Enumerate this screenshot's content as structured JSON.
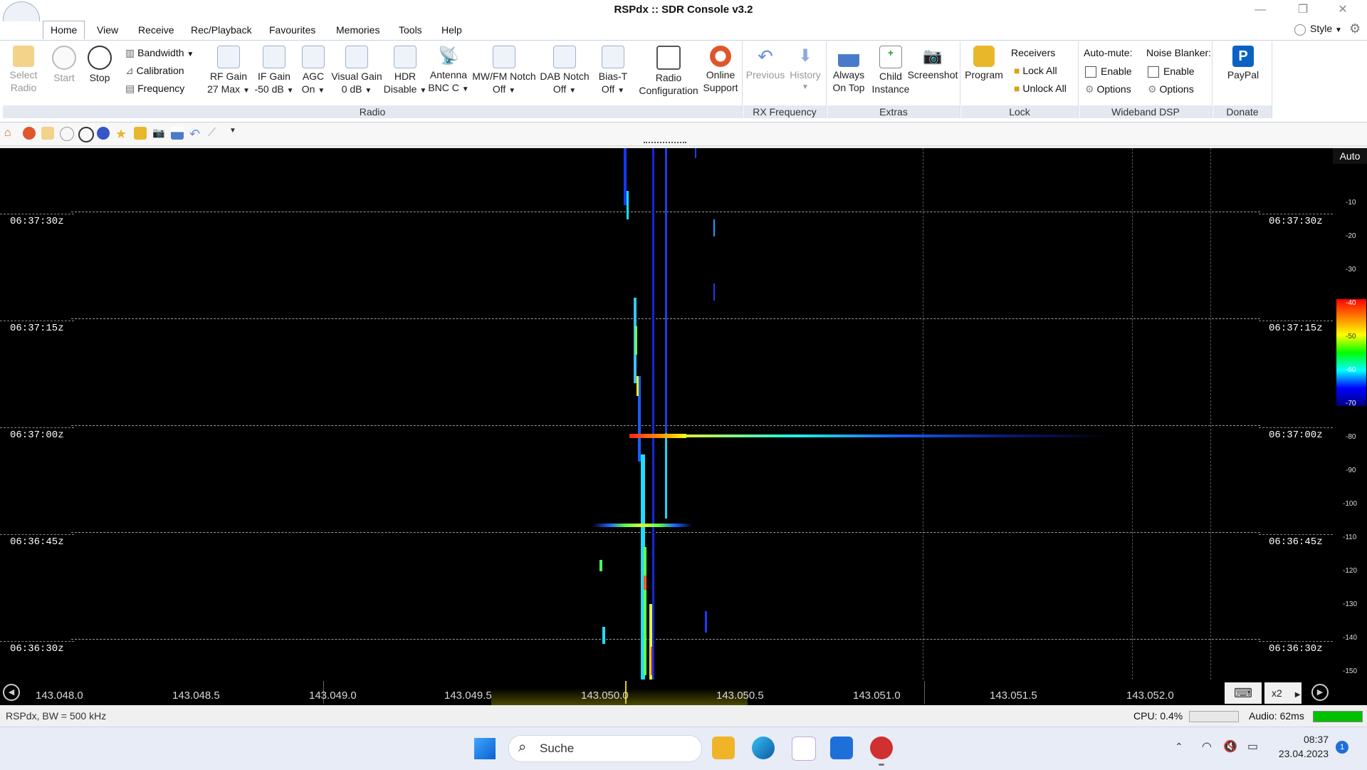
{
  "window": {
    "title": "RSPdx :: SDR Console v3.2",
    "style_label": "Style"
  },
  "menu": [
    "Home",
    "View",
    "Receive",
    "Rec/Playback",
    "Favourites",
    "Memories",
    "Tools",
    "Help"
  ],
  "ribbon": {
    "radio": {
      "group_label": "Radio",
      "select_radio": [
        "Select",
        "Radio"
      ],
      "start": "Start",
      "stop": "Stop",
      "bandwidth": "Bandwidth",
      "calibration": "Calibration",
      "frequency": "Frequency",
      "rf_gain": [
        "RF Gain",
        "27 Max"
      ],
      "if_gain": [
        "IF Gain",
        "-50 dB"
      ],
      "agc": [
        "AGC",
        "On"
      ],
      "visual_gain": [
        "Visual Gain",
        "0 dB"
      ],
      "hdr": [
        "HDR",
        "Disable"
      ],
      "antenna": [
        "Antenna",
        "BNC C"
      ],
      "mwfm_notch": [
        "MW/FM Notch",
        "Off"
      ],
      "dab_notch": [
        "DAB Notch",
        "Off"
      ],
      "bias_t": [
        "Bias-T",
        "Off"
      ],
      "radio_config": [
        "Radio",
        "Configuration"
      ],
      "online_support": [
        "Online",
        "Support"
      ]
    },
    "rx_frequency": {
      "group_label": "RX Frequency",
      "previous": "Previous",
      "history": "History"
    },
    "extras": {
      "group_label": "Extras",
      "always_on_top": [
        "Always",
        "On Top"
      ],
      "child_instance": [
        "Child",
        "Instance"
      ],
      "screenshot": "Screenshot"
    },
    "lock": {
      "group_label": "Lock",
      "program": "Program",
      "receivers": "Receivers",
      "lock_all": "Lock All",
      "unlock_all": "Unlock All"
    },
    "wideband": {
      "group_label": "Wideband DSP",
      "automute": "Auto-mute:",
      "noise_blanker": "Noise Blanker:",
      "enable": "Enable",
      "options": "Options"
    },
    "donate": {
      "group_label": "Donate",
      "paypal": "PayPal"
    }
  },
  "waterfall": {
    "time_labels": [
      "06:37:30z",
      "06:37:15z",
      "06:37:00z",
      "06:36:45z",
      "06:36:30z"
    ],
    "scale_auto": "Auto",
    "scale_ticks": [
      "-10",
      "-20",
      "-30",
      "-40",
      "-50",
      "-60",
      "-70",
      "-80",
      "-90",
      "-100",
      "-110",
      "-120",
      "-130",
      "-140",
      "-150"
    ]
  },
  "freq_axis": {
    "labels": [
      "143.048.0",
      "143.048.5",
      "143.049.0",
      "143.049.5",
      "143.050.0",
      "143.050.5",
      "143.051.0",
      "143.051.5",
      "143.052.0"
    ],
    "zoom": "x2"
  },
  "status": {
    "left": "RSPdx, BW = 500 kHz",
    "cpu": "CPU: 0.4%",
    "audio": "Audio: 62ms"
  },
  "taskbar": {
    "search_label": "Suche",
    "time": "08:37",
    "date": "23.04.2023",
    "notif_count": "1"
  },
  "colors": {
    "accent": "#1e6fd9",
    "ribbon_group_bg": "#e4e9f1",
    "audio_ok": "#00c000"
  }
}
